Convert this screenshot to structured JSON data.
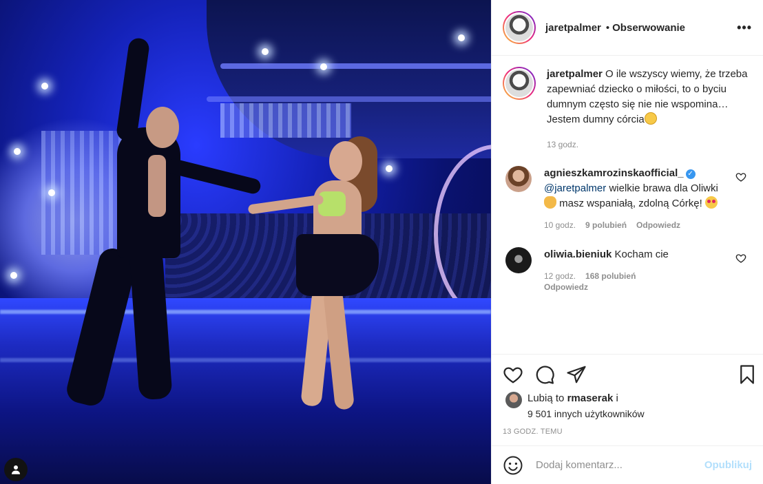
{
  "post": {
    "username": "jaretpalmer",
    "follow_label": "Obserwowanie",
    "more_label": "•••",
    "caption": {
      "username": "jaretpalmer",
      "text_line1": "O ile wszyscy wiemy, że trzeba zapewniać dziecko o miłości, to o byciu dumnym często się nie nie wspomina…",
      "text_line2": "Jestem dumny córcia",
      "time": "13 godz."
    },
    "comments": [
      {
        "username": "agnieszkamrozinskaofficial_",
        "mention": "@jaretpalmer",
        "text_a": "wielkie brawa dla Oliwki",
        "text_b": "masz wspaniałą, zdolną Córkę!",
        "time": "10 godz.",
        "likes": "9 polubień",
        "reply": "Odpowiedz"
      },
      {
        "username": "oliwia.bieniuk",
        "text": "Kocham cie",
        "time": "12 godz.",
        "likes": "168 polubień",
        "reply": "Odpowiedz"
      }
    ],
    "likes_line1_prefix": "Lubią to",
    "likes_user": "rmaserak",
    "likes_line1_suffix": "i",
    "likes_line2": "9 501 innych użytkowników",
    "post_time": "13 GODZ. TEMU",
    "comment_placeholder": "Dodaj komentarz...",
    "publish_label": "Opublikuj"
  },
  "icons": {
    "heart": "heart-icon",
    "comment": "comment-icon",
    "share": "share-icon",
    "save": "bookmark-icon",
    "emoji": "emoji-icon",
    "user_tag": "user-tag-icon"
  }
}
